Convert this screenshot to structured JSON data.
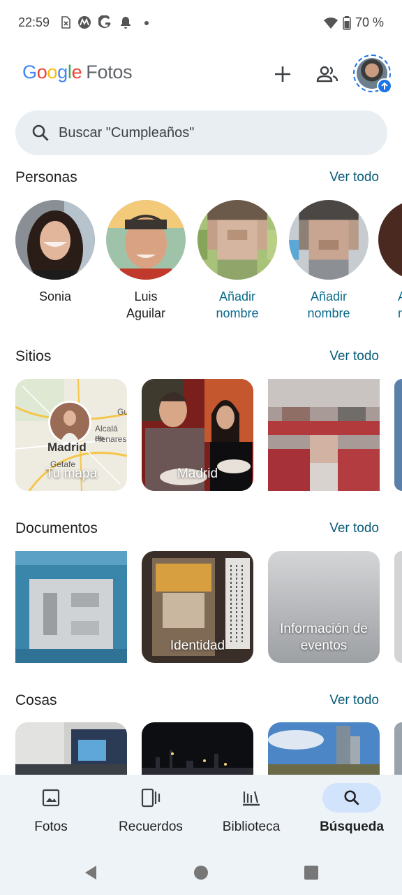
{
  "status_bar": {
    "time": "22:59",
    "battery": "70 %",
    "icons": [
      "sim-off-icon",
      "motorola-icon",
      "google-icon",
      "notification-bell-icon",
      "dot-icon",
      "wifi-icon",
      "battery-icon"
    ]
  },
  "header": {
    "logo_google": [
      "G",
      "o",
      "o",
      "g",
      "l",
      "e"
    ],
    "logo_product": "Fotos",
    "add_icon": "plus-icon",
    "sharing_icon": "people-icon"
  },
  "search": {
    "placeholder": "Buscar \"Cumpleaños\""
  },
  "sections": {
    "people": {
      "title": "Personas",
      "see_all": "Ver todo",
      "items": [
        {
          "name_line1": "Sonia",
          "name_line2": ""
        },
        {
          "name_line1": "Luis",
          "name_line2": "Aguilar"
        },
        {
          "name_line1": "Añadir",
          "name_line2": "nombre"
        },
        {
          "name_line1": "Añadir",
          "name_line2": "nombre"
        },
        {
          "name_line1": "A",
          "name_line2": "n"
        }
      ]
    },
    "places": {
      "title": "Sitios",
      "see_all": "Ver todo",
      "items": [
        {
          "label": "Tu mapa",
          "map_city": "Madrid",
          "map_towns": [
            "Alcalá de",
            "Henares",
            "Getafe",
            "Gu"
          ]
        },
        {
          "label": "Madrid"
        },
        {
          "label": ""
        }
      ]
    },
    "documents": {
      "title": "Documentos",
      "see_all": "Ver todo",
      "items": [
        {
          "label": ""
        },
        {
          "label": "Identidad"
        },
        {
          "label": "Información de eventos"
        }
      ]
    },
    "things": {
      "title": "Cosas",
      "see_all": "Ver todo"
    }
  },
  "bottom_nav": {
    "items": [
      {
        "label": "Fotos",
        "icon": "photo-icon",
        "active": false
      },
      {
        "label": "Recuerdos",
        "icon": "memories-icon",
        "active": false
      },
      {
        "label": "Biblioteca",
        "icon": "library-icon",
        "active": false
      },
      {
        "label": "Búsqueda",
        "icon": "search-icon",
        "active": true
      }
    ]
  },
  "colors": {
    "accent": "#0a5b78",
    "search_bg": "#e9eef3",
    "nav_bg": "#eef3f7",
    "active_pill": "#d2e3fc"
  }
}
